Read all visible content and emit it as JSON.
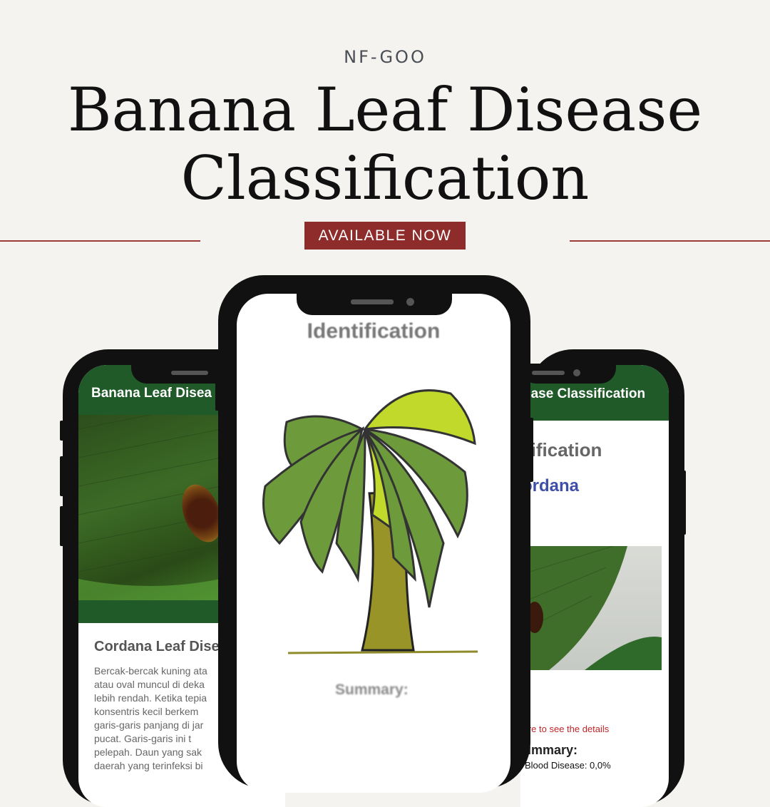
{
  "brand": "NF-GOO",
  "headline": [
    "Banana Leaf Disease",
    "Classification"
  ],
  "badge": "AVAILABLE NOW",
  "colors": {
    "background": "#f4f3ef",
    "accent": "#8e2c2c",
    "app_bar": "#1f5a28"
  },
  "left_screen": {
    "app_title": "Banana Leaf Disea",
    "card_title": "Cordana Leaf Dise",
    "body_lines": [
      "Bercak-bercak kuning ata",
      "atau oval muncul di deka",
      "lebih rendah. Ketika tepia",
      "konsentris kecil berkem",
      "garis-garis panjang di jar",
      "pucat. Garis-garis ini t",
      "pelepah. Daun yang sak",
      "daerah yang terinfeksi bi"
    ]
  },
  "center_screen": {
    "heading": "Identification",
    "summary_label": "Summary:",
    "illustration": "banana-tree-icon"
  },
  "right_screen": {
    "app_title": "ease Classification",
    "heading": "tification",
    "result": "ordana",
    "hint": "ture to see the details",
    "summary_label": "ummary:",
    "summary_line": "Blood Disease: 0,0%"
  }
}
